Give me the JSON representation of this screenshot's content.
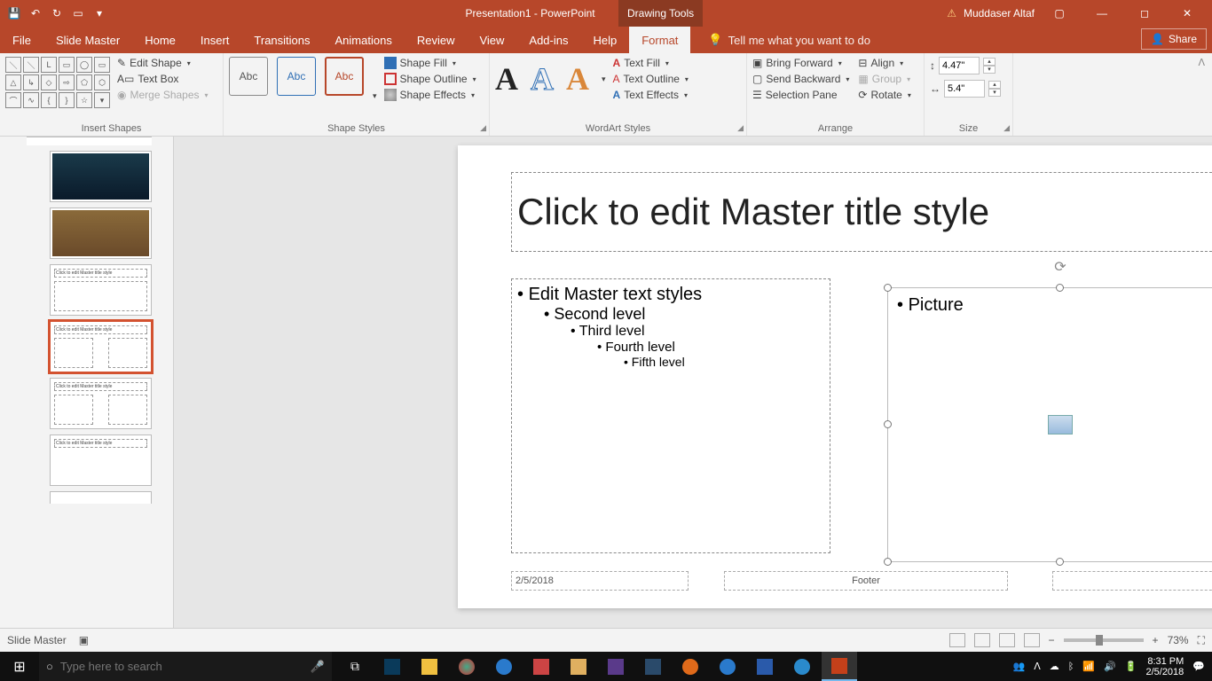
{
  "titlebar": {
    "doc_title": "Presentation1 - PowerPoint",
    "contextual_tab": "Drawing Tools",
    "user": "Muddaser Altaf"
  },
  "tabs": {
    "file": "File",
    "slide_master": "Slide Master",
    "home": "Home",
    "insert": "Insert",
    "transitions": "Transitions",
    "animations": "Animations",
    "review": "Review",
    "view": "View",
    "addins": "Add-ins",
    "help": "Help",
    "format": "Format",
    "tellme": "Tell me what you want to do",
    "share": "Share"
  },
  "ribbon": {
    "insert_shapes": {
      "edit_shape": "Edit Shape",
      "text_box": "Text Box",
      "merge_shapes": "Merge Shapes",
      "label": "Insert Shapes"
    },
    "shape_styles": {
      "swatch": "Abc",
      "shape_fill": "Shape Fill",
      "shape_outline": "Shape Outline",
      "shape_effects": "Shape Effects",
      "label": "Shape Styles"
    },
    "wordart": {
      "text_fill": "Text Fill",
      "text_outline": "Text Outline",
      "text_effects": "Text Effects",
      "label": "WordArt Styles"
    },
    "arrange": {
      "bring_forward": "Bring Forward",
      "send_backward": "Send Backward",
      "selection_pane": "Selection Pane",
      "align": "Align",
      "group": "Group",
      "rotate": "Rotate",
      "label": "Arrange"
    },
    "size": {
      "height": "4.47\"",
      "width": "5.4\"",
      "label": "Size"
    }
  },
  "slide": {
    "title": "Click to edit Master title style",
    "bullets": {
      "l1": "Edit Master text styles",
      "l2": "Second level",
      "l3": "Third level",
      "l4": "Fourth level",
      "l5": "Fifth level"
    },
    "picture_label": "Picture",
    "date": "2/5/2018",
    "footer": "Footer",
    "slidenum": "‹#›"
  },
  "thumbs": {
    "t3_title": "Click to edit Master title style",
    "t4_title": "Click to edit Master title style",
    "t5_title": "Click to edit Master title style",
    "t6_title": "Click to edit Master title style"
  },
  "statusbar": {
    "mode": "Slide Master",
    "zoom": "73%"
  },
  "taskbar": {
    "search_placeholder": "Type here to search",
    "time": "8:31 PM",
    "date": "2/5/2018"
  }
}
